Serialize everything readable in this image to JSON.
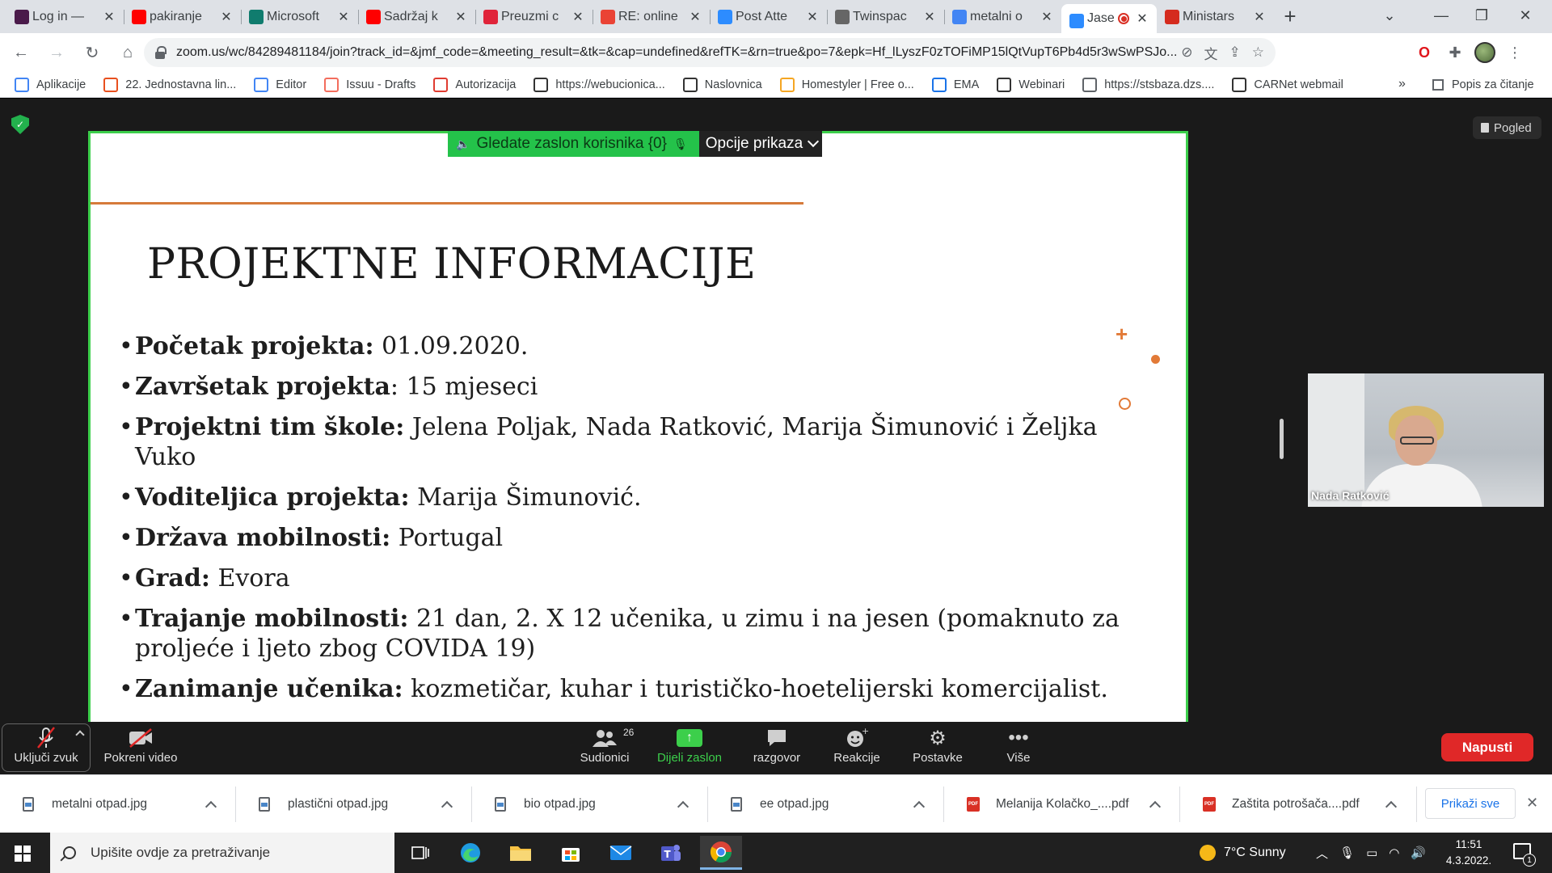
{
  "browser": {
    "tabs": [
      {
        "label": "Log in —",
        "icon": "quizlet-icon",
        "color": "#4a1a4a"
      },
      {
        "label": "pakiranje",
        "icon": "youtube-icon",
        "color": "#ff0000"
      },
      {
        "label": "Microsoft",
        "icon": "ms-sway-icon",
        "color": "#107c6e"
      },
      {
        "label": "Sadržaj k",
        "icon": "youtube-icon",
        "color": "#ff0000"
      },
      {
        "label": "Preuzmi c",
        "icon": "heart-icon",
        "color": "#e0243a"
      },
      {
        "label": "RE: online",
        "icon": "gmail-icon",
        "color": "#ea4335"
      },
      {
        "label": "Post Atte",
        "icon": "zoom-icon",
        "color": "#2d8cff"
      },
      {
        "label": "Twinspac",
        "icon": "twinspace-icon",
        "color": "#666666"
      },
      {
        "label": "metalni o",
        "icon": "google-icon",
        "color": "#4285f4"
      },
      {
        "label": "Jase",
        "icon": "zoom-icon",
        "color": "#2d8cff",
        "active": true
      },
      {
        "label": "Ministars",
        "icon": "croatia-icon",
        "color": "#d52b1e"
      }
    ],
    "url": "zoom.us/wc/84289481184/join?track_id=&jmf_code=&meeting_result=&tk=&cap=undefined&refTK=&rn=true&po=7&epk=Hf_lLyszF0zTOFiMP15lQtVupT6Pb4d5r3wSwPSJo...",
    "bookmarks": [
      {
        "label": "Aplikacije",
        "icon": "apps-grid-icon",
        "color": "#4285f4"
      },
      {
        "label": "22. Jednostavna lin...",
        "icon": "bookmark-c-icon",
        "color": "#e8501e"
      },
      {
        "label": "Editor",
        "icon": "google-icon",
        "color": "#4285f4"
      },
      {
        "label": "Issuu - Drafts",
        "icon": "issuu-icon",
        "color": "#f36d5d"
      },
      {
        "label": "Autorizacija",
        "icon": "autorizacija-icon",
        "color": "#e03c31"
      },
      {
        "label": "https://webucionica...",
        "icon": "w-icon",
        "color": "#333333"
      },
      {
        "label": "Naslovnica",
        "icon": "w-icon",
        "color": "#333333"
      },
      {
        "label": "Homestyler | Free o...",
        "icon": "homestyler-icon",
        "color": "#f5a623"
      },
      {
        "label": "EMA",
        "icon": "ema-icon",
        "color": "#1a73e8"
      },
      {
        "label": "Webinari",
        "icon": "graduation-cap-icon",
        "color": "#333333"
      },
      {
        "label": "https://stsbaza.dzs....",
        "icon": "globe-icon",
        "color": "#5f6368"
      },
      {
        "label": "CARNet webmail",
        "icon": "mail-icon",
        "color": "#333333"
      }
    ],
    "bookmarks_more": "»",
    "reading_list": "Popis za čitanje"
  },
  "meeting": {
    "view_button": "Pogled",
    "share_banner": "Gledate zaslon korisnika {0}",
    "view_options": "Opcije prikaza",
    "participant_name": "Nada Ratković",
    "slide": {
      "title": "PROJEKTNE INFORMACIJE",
      "bullets": [
        {
          "label": "Početak projekta:",
          "text": " 01.09.2020."
        },
        {
          "label": "Završetak projekta",
          "text": ": 15 mjeseci"
        },
        {
          "label": "Projektni tim škole:",
          "text": "  Jelena Poljak, Nada Ratković, Marija Šimunović i Željka Vuko"
        },
        {
          "label": "Voditeljica projekta:",
          "text": " Marija Šimunović."
        },
        {
          "label": "Država mobilnosti:",
          "text": " Portugal"
        },
        {
          "label": "Grad:",
          "text": " Evora"
        },
        {
          "label": "Trajanje mobilnosti:",
          "text": " 21 dan,  2. X 12 učenika, u zimu i na jesen (pomaknuto za proljeće i ljeto zbog COVIDA 19)"
        },
        {
          "label": "Zanimanje učenika:",
          "text": " kozmetičar, kuhar i turističko-hoetelijerski komercijalist."
        }
      ]
    },
    "controls": {
      "audio": "Uključi zvuk",
      "video": "Pokreni video",
      "participants": "Sudionici",
      "participants_count": "26",
      "share": "Dijeli zaslon",
      "chat": "razgovor",
      "reactions": "Reakcije",
      "settings": "Postavke",
      "more": "Više",
      "leave": "Napusti"
    }
  },
  "downloads": {
    "items": [
      {
        "name": "metalni otpad.jpg",
        "type": "jpg"
      },
      {
        "name": "plastični otpad.jpg",
        "type": "jpg"
      },
      {
        "name": "bio otpad.jpg",
        "type": "jpg"
      },
      {
        "name": "ee otpad.jpg",
        "type": "jpg"
      },
      {
        "name": "Melanija Kolačko_....pdf",
        "type": "pdf"
      },
      {
        "name": "Zaštita potrošača....pdf",
        "type": "pdf"
      }
    ],
    "show_all": "Prikaži sve"
  },
  "taskbar": {
    "search_placeholder": "Upišite ovdje za pretraživanje",
    "weather": "7°C  Sunny",
    "time": "11:51",
    "date": "4.3.2022.",
    "notifications": "1"
  }
}
